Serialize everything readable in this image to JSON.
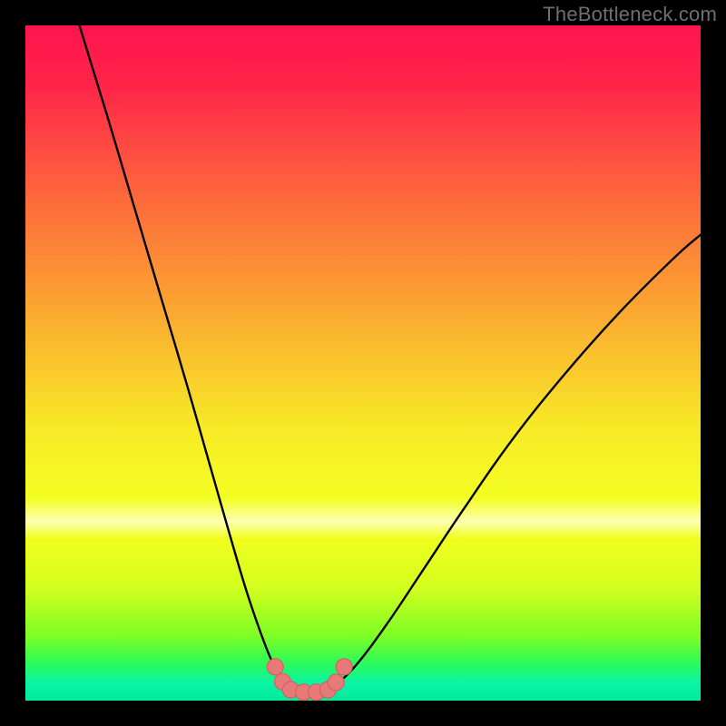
{
  "watermark": "TheBottleneck.com",
  "colors": {
    "frame": "#000000",
    "curve": "#000000",
    "marker_fill": "#E77A79",
    "marker_stroke": "#D85F5E",
    "gradient_stops": [
      {
        "offset": 0.0,
        "color": "#FF144E"
      },
      {
        "offset": 0.09,
        "color": "#FF2549"
      },
      {
        "offset": 0.22,
        "color": "#FE5B3E"
      },
      {
        "offset": 0.35,
        "color": "#FC8C35"
      },
      {
        "offset": 0.48,
        "color": "#FABE2E"
      },
      {
        "offset": 0.6,
        "color": "#F7EB26"
      },
      {
        "offset": 0.7,
        "color": "#F4FE22"
      },
      {
        "offset": 0.735,
        "color": "#FDFFB4"
      },
      {
        "offset": 0.76,
        "color": "#F1FE1F"
      },
      {
        "offset": 0.83,
        "color": "#D5FE1E"
      },
      {
        "offset": 0.905,
        "color": "#7DFE26"
      },
      {
        "offset": 0.945,
        "color": "#2BFB5A"
      },
      {
        "offset": 0.975,
        "color": "#0AF3A7"
      },
      {
        "offset": 1.0,
        "color": "#02EC9B"
      }
    ]
  },
  "chart_data": {
    "type": "line",
    "title": "",
    "xlabel": "",
    "ylabel": "",
    "xlim": [
      0,
      100
    ],
    "ylim": [
      0,
      100
    ],
    "grid": false,
    "series": [
      {
        "name": "curve-left",
        "x": [
          8.0,
          12.0,
          16.0,
          20.0,
          24.0,
          27.0,
          30.0,
          32.5,
          34.5,
          36.0,
          37.2,
          38.2,
          39.0
        ],
        "y": [
          100.0,
          87.0,
          73.5,
          60.0,
          46.5,
          36.0,
          25.5,
          17.0,
          11.0,
          7.0,
          4.3,
          2.5,
          1.8
        ]
      },
      {
        "name": "curve-flat",
        "x": [
          39.0,
          41.0,
          43.0,
          45.0
        ],
        "y": [
          1.8,
          1.3,
          1.3,
          1.8
        ]
      },
      {
        "name": "curve-right",
        "x": [
          45.0,
          47.0,
          50.0,
          54.0,
          59.0,
          65.0,
          72.0,
          80.0,
          88.0,
          96.0,
          100.0
        ],
        "y": [
          1.8,
          3.2,
          6.5,
          12.0,
          19.5,
          28.5,
          38.5,
          48.5,
          57.5,
          65.5,
          69.0
        ]
      }
    ],
    "markers": [
      {
        "x": 37.0,
        "y": 5.0
      },
      {
        "x": 38.1,
        "y": 2.8
      },
      {
        "x": 39.3,
        "y": 1.6
      },
      {
        "x": 41.2,
        "y": 1.25
      },
      {
        "x": 43.1,
        "y": 1.25
      },
      {
        "x": 44.8,
        "y": 1.6
      },
      {
        "x": 46.0,
        "y": 2.7
      },
      {
        "x": 47.2,
        "y": 5.0
      }
    ],
    "marker_radius_px": 9
  }
}
